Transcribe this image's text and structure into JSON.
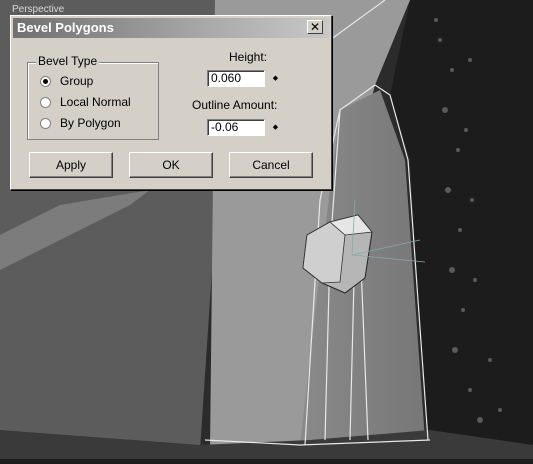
{
  "viewport": {
    "label": "Perspective"
  },
  "dialog": {
    "title": "Bevel Polygons",
    "close_glyph": "✕",
    "bevel_type": {
      "legend": "Bevel Type",
      "options": [
        {
          "label": "Group",
          "selected": true
        },
        {
          "label": "Local Normal",
          "selected": false
        },
        {
          "label": "By Polygon",
          "selected": false
        }
      ]
    },
    "height": {
      "label": "Height:",
      "value": "0.060"
    },
    "outline": {
      "label": "Outline Amount:",
      "value": "-0.06"
    },
    "spinner_glyph": "◆",
    "buttons": {
      "apply": "Apply",
      "ok": "OK",
      "cancel": "Cancel"
    }
  }
}
